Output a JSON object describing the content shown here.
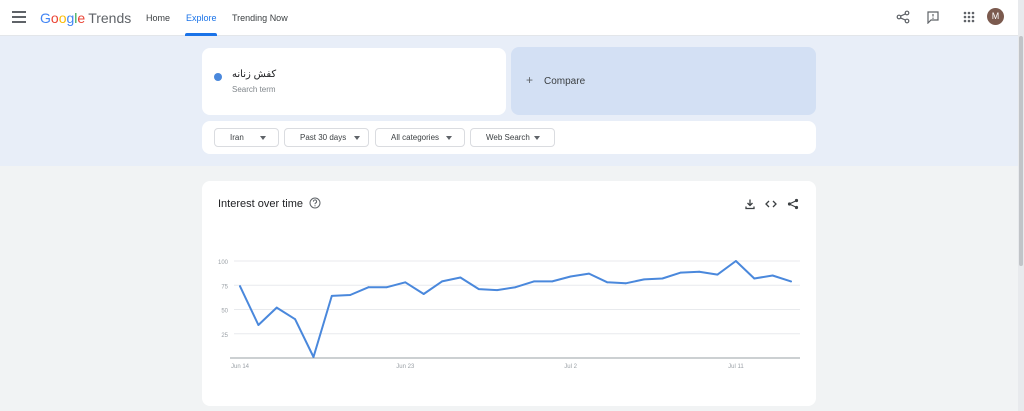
{
  "header": {
    "logo_letters": [
      "G",
      "o",
      "o",
      "g",
      "l",
      "e"
    ],
    "logo_product": "Trends",
    "nav": [
      {
        "label": "Home",
        "active": false
      },
      {
        "label": "Explore",
        "active": true
      },
      {
        "label": "Trending Now",
        "active": false
      }
    ],
    "icons": [
      "menu-icon",
      "share-icon",
      "feedback-icon",
      "apps-icon"
    ],
    "avatar_initial": "M"
  },
  "search": {
    "term": "کفش زنانه",
    "term_type": "Search term",
    "term_color": "#4a88dc",
    "compare_label": "Compare"
  },
  "filters": {
    "region": "Iran",
    "time_range": "Past 30 days",
    "category": "All categories",
    "search_type": "Web Search"
  },
  "chart_card": {
    "title": "Interest over time",
    "icons": [
      "help-icon",
      "download-icon",
      "embed-icon",
      "share-icon"
    ]
  },
  "chart_data": {
    "type": "line",
    "title": "",
    "xlabel": "",
    "ylabel": "",
    "ylim": [
      0,
      100
    ],
    "y_ticks": [
      100,
      75,
      50,
      25
    ],
    "x_tick_labels": [
      {
        "label": "Jun 14",
        "index": 0
      },
      {
        "label": "Jun 23",
        "index": 9
      },
      {
        "label": "Jul 2",
        "index": 18
      },
      {
        "label": "Jul 11",
        "index": 27
      }
    ],
    "grid": true,
    "color": "#4a88dc",
    "series": [
      {
        "values": [
          74,
          34,
          52,
          40,
          1,
          64,
          65,
          73,
          73,
          78,
          66,
          79,
          83,
          71,
          70,
          73,
          79,
          79,
          84,
          87,
          78,
          77,
          81,
          82,
          88,
          89,
          86,
          100,
          82,
          85,
          79
        ]
      }
    ]
  }
}
